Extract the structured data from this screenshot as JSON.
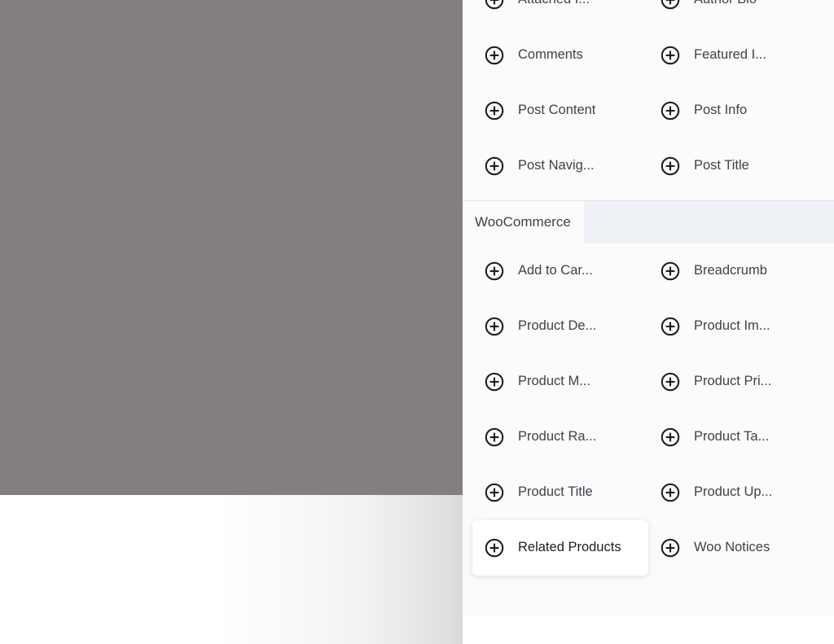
{
  "overlay": {
    "scrim_color": "#827f7e"
  },
  "panel": {
    "background_color": "#fbfbfc",
    "add_icon_name": "plus-circle-icon",
    "sections": [
      {
        "id": "theme",
        "header": null,
        "items": [
          {
            "label": "Attached I...",
            "icon": "plus-circle-icon",
            "hovered": false
          },
          {
            "label": "Author Bio",
            "icon": "plus-circle-icon",
            "hovered": false
          },
          {
            "label": "Comments",
            "icon": "plus-circle-icon",
            "hovered": false
          },
          {
            "label": "Featured I...",
            "icon": "plus-circle-icon",
            "hovered": false
          },
          {
            "label": "Post Content",
            "icon": "plus-circle-icon",
            "hovered": false
          },
          {
            "label": "Post Info",
            "icon": "plus-circle-icon",
            "hovered": false
          },
          {
            "label": "Post Navig...",
            "icon": "plus-circle-icon",
            "hovered": false
          },
          {
            "label": "Post Title",
            "icon": "plus-circle-icon",
            "hovered": false
          }
        ]
      },
      {
        "id": "woocommerce",
        "header": {
          "label": "WooCommerce",
          "tab_background": "#fbfbfc",
          "strip_background": "#eef1f5",
          "border_color": "#e0e4ea"
        },
        "items": [
          {
            "label": "Add to Car...",
            "icon": "plus-circle-icon",
            "hovered": false
          },
          {
            "label": "Breadcrumb",
            "icon": "plus-circle-icon",
            "hovered": false
          },
          {
            "label": "Product De...",
            "icon": "plus-circle-icon",
            "hovered": false
          },
          {
            "label": "Product Im...",
            "icon": "plus-circle-icon",
            "hovered": false
          },
          {
            "label": "Product M...",
            "icon": "plus-circle-icon",
            "hovered": false
          },
          {
            "label": "Product Pri...",
            "icon": "plus-circle-icon",
            "hovered": false
          },
          {
            "label": "Product Ra...",
            "icon": "plus-circle-icon",
            "hovered": false
          },
          {
            "label": "Product Ta...",
            "icon": "plus-circle-icon",
            "hovered": false
          },
          {
            "label": "Product Title",
            "icon": "plus-circle-icon",
            "hovered": false
          },
          {
            "label": "Product Up...",
            "icon": "plus-circle-icon",
            "hovered": false
          },
          {
            "label": "Related Products",
            "icon": "plus-circle-icon",
            "hovered": true
          },
          {
            "label": "Woo Notices",
            "icon": "plus-circle-icon",
            "hovered": false
          }
        ]
      }
    ]
  }
}
